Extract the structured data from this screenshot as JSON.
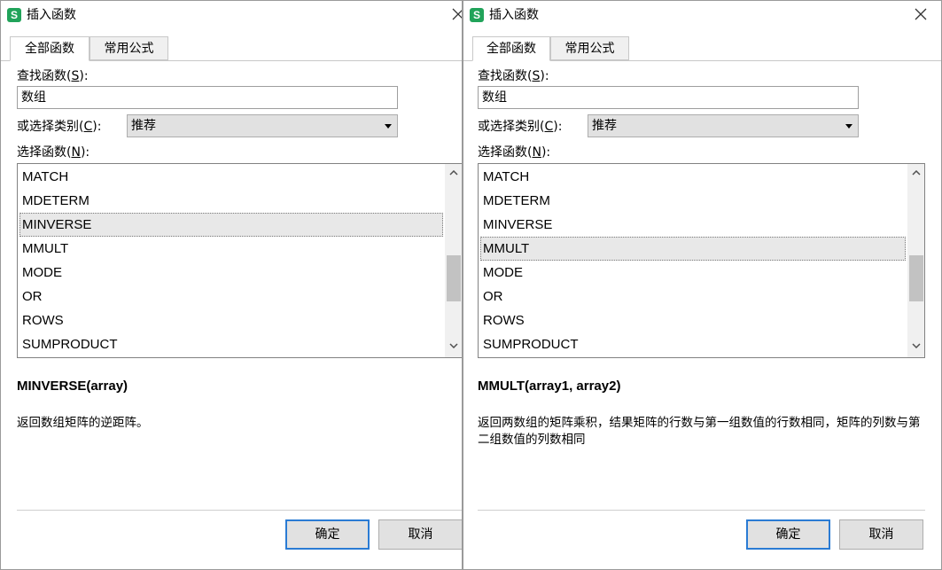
{
  "dialogs": [
    {
      "title": "插入函数",
      "app_icon_letter": "S",
      "tabs": [
        "全部函数",
        "常用公式"
      ],
      "search": {
        "label": "查找函数(",
        "label_key": "S",
        "label_end": "):",
        "value": "数组"
      },
      "category": {
        "label": "或选择类别(",
        "label_key": "C",
        "label_end": "):",
        "value": "推荐"
      },
      "function_list": {
        "label": "选择函数(",
        "label_key": "N",
        "label_end": "):",
        "items": [
          "MATCH",
          "MDETERM",
          "MINVERSE",
          "MMULT",
          "MODE",
          "OR",
          "ROWS",
          "SUMPRODUCT"
        ],
        "selected_index": 2
      },
      "signature": "MINVERSE(array)",
      "description": "返回数组矩阵的逆距阵。",
      "ok_label": "确定",
      "cancel_label": "取消"
    },
    {
      "title": "插入函数",
      "app_icon_letter": "S",
      "tabs": [
        "全部函数",
        "常用公式"
      ],
      "search": {
        "label": "查找函数(",
        "label_key": "S",
        "label_end": "):",
        "value": "数组"
      },
      "category": {
        "label": "或选择类别(",
        "label_key": "C",
        "label_end": "):",
        "value": "推荐"
      },
      "function_list": {
        "label": "选择函数(",
        "label_key": "N",
        "label_end": "):",
        "items": [
          "MATCH",
          "MDETERM",
          "MINVERSE",
          "MMULT",
          "MODE",
          "OR",
          "ROWS",
          "SUMPRODUCT"
        ],
        "selected_index": 3
      },
      "signature": "MMULT(array1, array2)",
      "description": "返回两数组的矩阵乘积，结果矩阵的行数与第一组数值的行数相同，矩阵的列数与第二组数值的列数相同",
      "ok_label": "确定",
      "cancel_label": "取消"
    }
  ],
  "icons": {
    "close": "close-icon",
    "scroll_up": "chevron-up-icon",
    "scroll_down": "chevron-down-icon",
    "dropdown": "caret-down-icon"
  },
  "colors": {
    "app_icon": "#21a35a",
    "primary_button_border": "#2a7bd4",
    "selected_row": "#e8e8e8"
  }
}
